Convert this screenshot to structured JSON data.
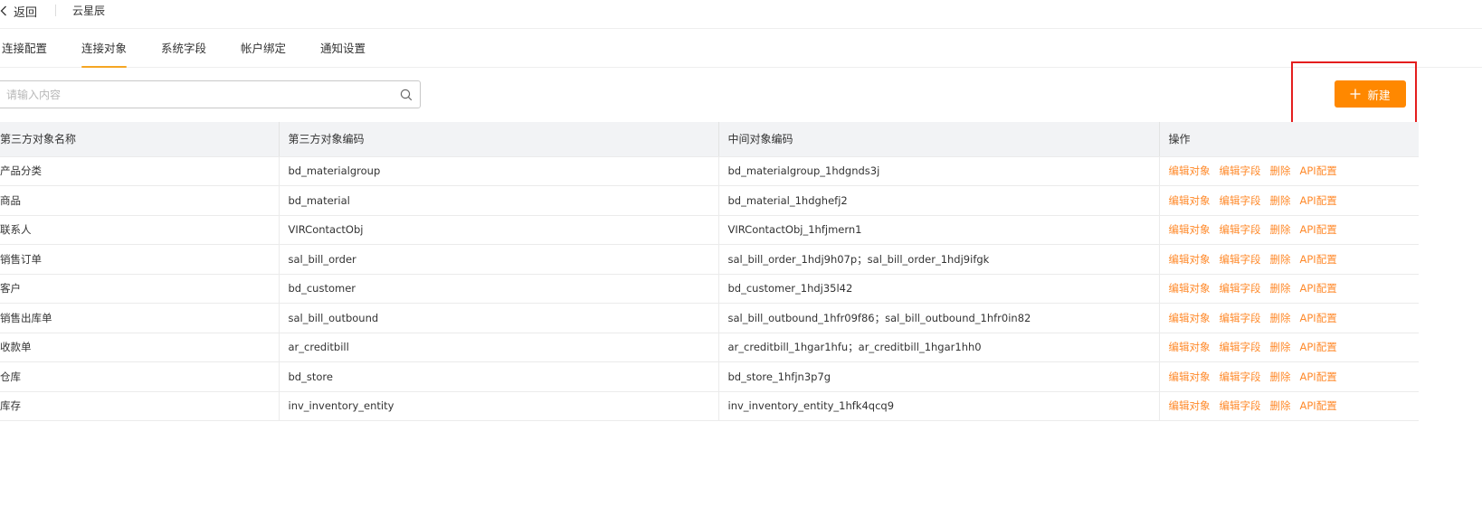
{
  "header": {
    "back_label": "返回",
    "app_name": "云星辰"
  },
  "tabs": [
    {
      "label": "连接配置",
      "active": false
    },
    {
      "label": "连接对象",
      "active": true
    },
    {
      "label": "系统字段",
      "active": false
    },
    {
      "label": "帐户绑定",
      "active": false
    },
    {
      "label": "通知设置",
      "active": false
    }
  ],
  "search": {
    "value": "",
    "placeholder": "请输入内容",
    "icon": "search-icon"
  },
  "new_button": {
    "label": "新建",
    "icon": "plus-icon",
    "color": "#ff8800"
  },
  "accent_color": "#f5a623",
  "annotation_color": "#e41e1e",
  "table": {
    "columns": [
      "第三方对象名称",
      "第三方对象编码",
      "中间对象编码",
      "操作"
    ],
    "actions": [
      "编辑对象",
      "编辑字段",
      "删除",
      "API配置"
    ],
    "rows": [
      {
        "name": "产品分类",
        "code": "bd_materialgroup",
        "mid_code": "bd_materialgroup_1hdgnds3j"
      },
      {
        "name": "商品",
        "code": "bd_material",
        "mid_code": "bd_material_1hdghefj2"
      },
      {
        "name": "联系人",
        "code": "VIRContactObj",
        "mid_code": "VIRContactObj_1hfjmern1"
      },
      {
        "name": "销售订单",
        "code": "sal_bill_order",
        "mid_code": "sal_bill_order_1hdj9h07p；sal_bill_order_1hdj9ifgk"
      },
      {
        "name": "客户",
        "code": "bd_customer",
        "mid_code": "bd_customer_1hdj35l42"
      },
      {
        "name": "销售出库单",
        "code": "sal_bill_outbound",
        "mid_code": "sal_bill_outbound_1hfr09f86；sal_bill_outbound_1hfr0in82"
      },
      {
        "name": "收款单",
        "code": "ar_creditbill",
        "mid_code": "ar_creditbill_1hgar1hfu；ar_creditbill_1hgar1hh0"
      },
      {
        "name": "仓库",
        "code": "bd_store",
        "mid_code": "bd_store_1hfjn3p7g"
      },
      {
        "name": "库存",
        "code": "inv_inventory_entity",
        "mid_code": "inv_inventory_entity_1hfk4qcq9"
      }
    ]
  }
}
